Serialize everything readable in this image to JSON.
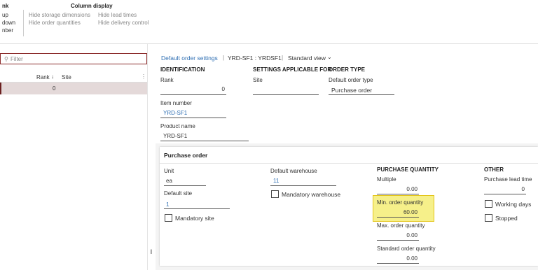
{
  "ribbon": {
    "left_items": [
      "nk",
      "up",
      "down",
      "nber"
    ],
    "group_title": "Column display",
    "hide_storage": "Hide storage dimensions",
    "hide_lead": "Hide lead times",
    "hide_order_qty": "Hide order quantities",
    "hide_delivery": "Hide delivery control"
  },
  "grid": {
    "filter_placeholder": "Filter",
    "col_rank": "Rank",
    "col_site": "Site",
    "row_rank": "0"
  },
  "header": {
    "link": "Default order settings",
    "record": "YRD-SF1 : YRDSF1",
    "view": "Standard view"
  },
  "identification": {
    "title": "IDENTIFICATION",
    "rank_label": "Rank",
    "rank_value": "0",
    "item_label": "Item number",
    "item_value": "YRD-SF1",
    "product_label": "Product name",
    "product_value": "YRD-SF1"
  },
  "settings": {
    "title": "SETTINGS APPLICABLE FOR",
    "site_label": "Site"
  },
  "order_type": {
    "title": "ORDER TYPE",
    "label": "Default order type",
    "value": "Purchase order"
  },
  "purchase": {
    "section_title": "Purchase order",
    "unit_label": "Unit",
    "unit_value": "ea",
    "site_label": "Default site",
    "site_value": "1",
    "mandatory_site": "Mandatory site",
    "wh_label": "Default warehouse",
    "wh_value": "11",
    "mandatory_wh": "Mandatory warehouse",
    "qty_title": "PURCHASE QUANTITY",
    "multiple_label": "Multiple",
    "multiple_value": "0.00",
    "min_label": "Min. order quantity",
    "min_value": "60.00",
    "max_label": "Max. order quantity",
    "max_value": "0.00",
    "std_label": "Standard order quantity",
    "std_value": "0.00",
    "other_title": "OTHER",
    "lead_label": "Purchase lead time",
    "lead_value": "0",
    "working_days": "Working days",
    "stopped": "Stopped"
  },
  "colors": {
    "highlight": "#f6f08a",
    "highlight_border": "#e3c51a",
    "selected_row": "#e4d9d9",
    "link": "#2f6fb3"
  }
}
